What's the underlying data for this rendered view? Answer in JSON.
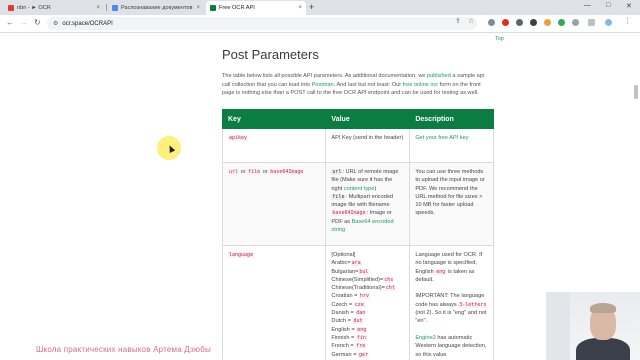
{
  "browser": {
    "tabs": [
      {
        "label": "nbn - ► OCR",
        "active": false
      },
      {
        "label": "Распознавание документов",
        "active": false
      },
      {
        "label": "Free OCR API",
        "active": true
      }
    ],
    "new_tab": "+",
    "window_controls": {
      "minimize": "—",
      "maximize": "□",
      "close": "✕"
    },
    "nav": {
      "back": "←",
      "forward": "→",
      "reload": "↻"
    },
    "url": "ocr.space/OCRAPI",
    "tab_close": "×"
  },
  "page": {
    "top_link": "Top",
    "heading": "Post Parameters",
    "intro": {
      "p1": "The table below lists all possible API parameters. As additional documentation, we ",
      "link1": "published",
      "p2": " a sample api call collection that you can load into ",
      "link2": "Postman",
      "p3": ". And last but not least: Our ",
      "link3": "free online ocr",
      "p4": " form on the front page is nothing else than a POST call to the free OCR API endpoint and can be used for testing as well."
    },
    "table": {
      "headers": [
        "Key",
        "Value",
        "Description"
      ],
      "row1": {
        "key": "apikey",
        "value": "API Key (send in the header)",
        "desc_link": "Get your free API key"
      },
      "row2": {
        "key_url": "url",
        "or1": "or",
        "key_file": "file",
        "or2": "or",
        "key_b64": "base64Image",
        "v_url": "url",
        "v_url_text": ": URL of remote image file (Make sure it has the right ",
        "v_ct": "content type",
        "v_ct_end": ")",
        "v_file": "file",
        "v_file_text": ": Multipart encoded image file with filename",
        "v_b64": "base64Image",
        "v_b64_text": ": Image or PDF as ",
        "v_b64_link": "Base64 encoded string",
        "desc": "You can use three methods to upload the input image or PDF. We recommend the URL method for file sizes > 10 MB for faster upload speeds."
      },
      "row3": {
        "key": "language",
        "optional": "[Optional]",
        "langs": [
          {
            "name": "Arabic",
            "code": "ara"
          },
          {
            "name": "Bulgarian",
            "code": "bul"
          },
          {
            "name": "Chinese(Simplified)",
            "code": "chs"
          },
          {
            "name": "Chinese(Traditional)",
            "code": "cht"
          },
          {
            "name": "Croatian",
            "code": "hrv"
          },
          {
            "name": "Czech",
            "code": "cze"
          },
          {
            "name": "Danish",
            "code": "dan"
          },
          {
            "name": "Dutch",
            "code": "dut"
          },
          {
            "name": "English",
            "code": "eng"
          },
          {
            "name": "Finnish",
            "code": "fin"
          },
          {
            "name": "French",
            "code": "fre"
          },
          {
            "name": "German",
            "code": "ger"
          }
        ],
        "eq": "=",
        "desc1": "Language used for OCR. If no language is specified, English ",
        "desc1_code": "eng",
        "desc1_end": " is taken as default.",
        "desc2": "IMPORTANT: The language code has always ",
        "desc2_code": "3-letters",
        "desc2_end": " (not 2). So it is \"eng\" and not \"en\".",
        "desc3_link": "Engine2",
        "desc3": " has automatic Western language detection, so this value"
      }
    }
  },
  "overlay": {
    "watermark": "Школа практических навыков Артема Дзюбы"
  },
  "colors": {
    "accent_green": "#0b7d43",
    "link_green": "#1e9d5a",
    "code_red": "#c7254e",
    "tab_strip": "#dee1e6",
    "highlight_yellow": "#ffec5a"
  }
}
